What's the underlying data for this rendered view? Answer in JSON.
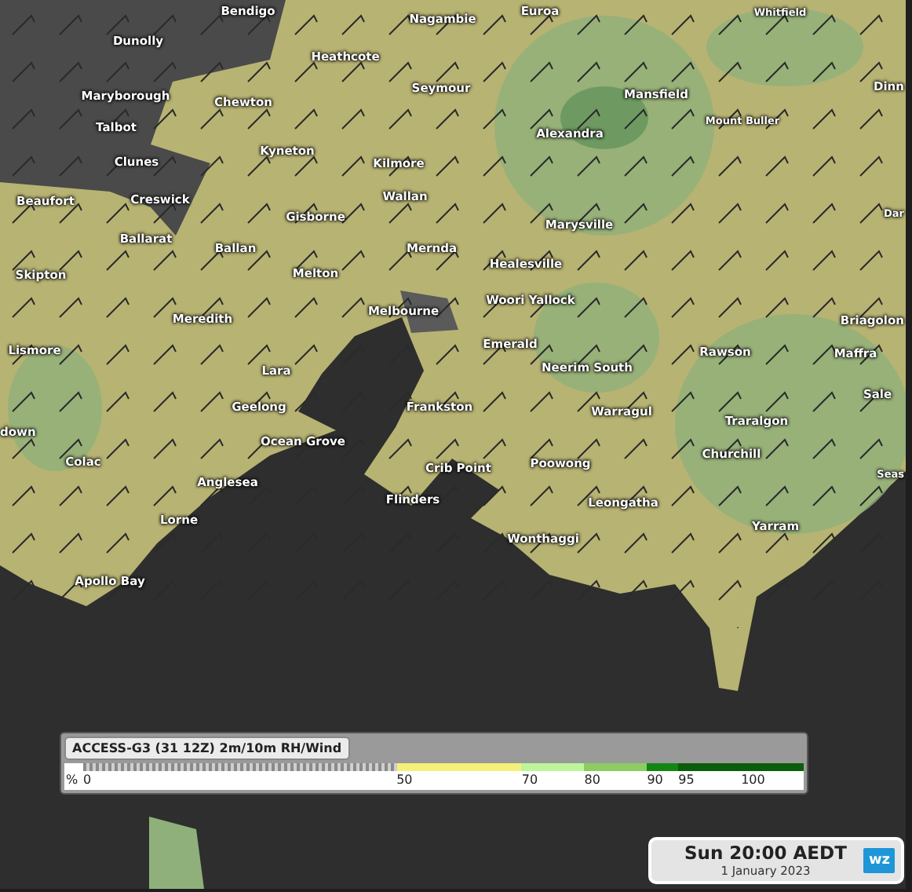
{
  "map": {
    "places": [
      "Bendigo",
      "Nagambie",
      "Euroa",
      "Whitfield",
      "Dunolly",
      "Heathcote",
      "Maryborough",
      "Chewton",
      "Seymour",
      "Mansfield",
      "Dinn",
      "Talbot",
      "Alexandra",
      "Mount Buller",
      "Clunes",
      "Kyneton",
      "Kilmore",
      "Beaufort",
      "Creswick",
      "Wallan",
      "Gisborne",
      "Marysville",
      "Dar",
      "Ballarat",
      "Ballan",
      "Mernda",
      "Skipton",
      "Melton",
      "Healesville",
      "Meredith",
      "Melbourne",
      "Woori Yallock",
      "Briagolon",
      "Lismore",
      "Lara",
      "Emerald",
      "Neerim South",
      "Rawson",
      "Maffra",
      "Geelong",
      "Frankston",
      "Warragul",
      "down",
      "Traralgon",
      "Sale",
      "Ocean Grove",
      "Colac",
      "Anglesea",
      "Crib Point",
      "Poowong",
      "Churchill",
      "Seas",
      "Flinders",
      "Lorne",
      "Leongatha",
      "Wonthaggi",
      "Yarram",
      "Apollo Bay"
    ]
  },
  "legend": {
    "title": "ACCESS-G3 (31 12Z) 2m/10m RH/Wind",
    "unit": "%",
    "segments": [
      {
        "kind": "hatched",
        "color": "#8a8a8a"
      },
      {
        "kind": "solid",
        "color": "#f5f07a"
      },
      {
        "kind": "solid",
        "color": "#bdf59a"
      },
      {
        "kind": "solid",
        "color": "#8ccc63"
      },
      {
        "kind": "solid",
        "color": "#128612"
      },
      {
        "kind": "solid",
        "color": "#0a5e0a"
      }
    ],
    "ticks": [
      "0",
      "50",
      "70",
      "80",
      "90",
      "95",
      "100"
    ]
  },
  "time_box": {
    "time": "Sun 20:00 AEDT",
    "date": "1 January 2023",
    "logo": "wz"
  }
}
